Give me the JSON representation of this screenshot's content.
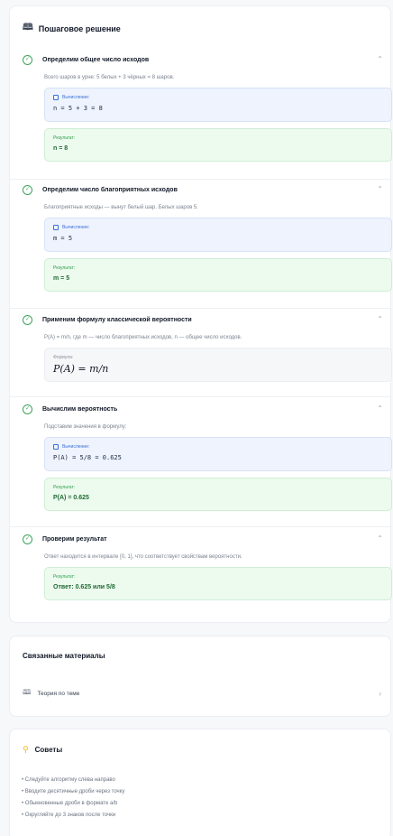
{
  "solution": {
    "title": "Пошаговое решение",
    "calc_label": "Вычисление:",
    "result_label": "Результат:",
    "formula_label": "Формула:",
    "steps": [
      {
        "title": "Определим общее число исходов",
        "desc": "Всего шаров в урне: 5 белых + 3 чёрных = 8 шаров.",
        "calc": "n = 5 + 3 = 8",
        "result": "n = 8"
      },
      {
        "title": "Определим число благоприятных исходов",
        "desc": "Благоприятные исходы — вынут белый шар. Белых шаров 5.",
        "calc": "m = 5",
        "result": "m = 5"
      },
      {
        "title": "Применим формулу классической вероятности",
        "desc": "P(A) = m/n, где m — число благоприятных исходов, n — общее число исходов.",
        "formula": "P(A) = m/n"
      },
      {
        "title": "Вычислим вероятность",
        "desc": "Подставим значения в формулу:",
        "calc": "P(A) = 5/8 = 0.625",
        "result": "P(A) = 0.625"
      },
      {
        "title": "Проверим результат",
        "desc": "Ответ находится в интервале [0, 1], что соответствует свойствам вероятности.",
        "result": "Ответ: 0.625 или 5/8"
      }
    ]
  },
  "related": {
    "title": "Связанные материалы",
    "item_label": "Теория по теме"
  },
  "tips": {
    "title": "Советы",
    "items": [
      "Следуйте алгоритму слева направо",
      "Вводите десятичные дроби через точку",
      "Обыкновенные дроби в формате a/b",
      "Округляйте до 3 знаков после точки"
    ]
  },
  "colors": {
    "success": "#3fa35c",
    "calc_accent": "#3b6fd8",
    "result_bg": "#edfaee",
    "calc_bg": "#eef3fd"
  }
}
